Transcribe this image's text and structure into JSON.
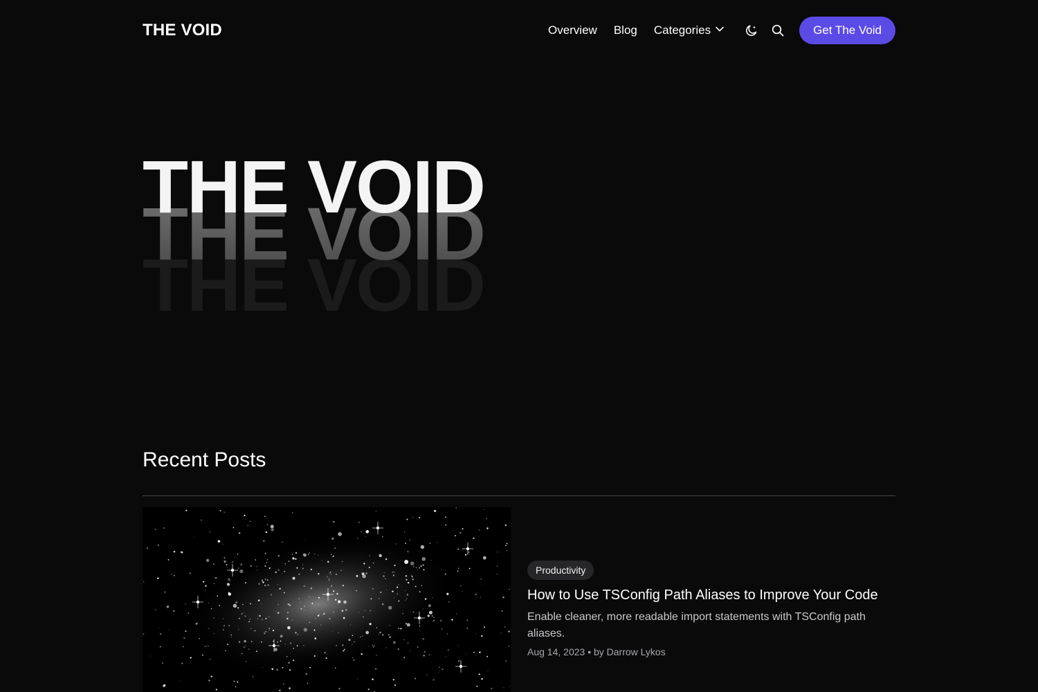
{
  "brand": {
    "logo_text": "THE VOID"
  },
  "nav": {
    "links": [
      "Overview",
      "Blog"
    ],
    "categories_label": "Categories",
    "cta_label": "Get The Void",
    "icons": [
      "moon-icon",
      "search-icon",
      "chevron-down-icon"
    ]
  },
  "hero": {
    "title": "THE VOID"
  },
  "recent": {
    "heading": "Recent Posts",
    "posts": [
      {
        "category": "Productivity",
        "title": "How to Use TSConfig Path Aliases to Improve Your Code",
        "excerpt": "Enable cleaner, more readable import statements with TSConfig path aliases.",
        "date": "Aug 14, 2023",
        "author_prefix": "• by",
        "author": "Darrow Lykos"
      }
    ]
  },
  "colors": {
    "background": "#0a0a0b",
    "accent": "#5b4be6",
    "badge_bg": "#262628"
  }
}
